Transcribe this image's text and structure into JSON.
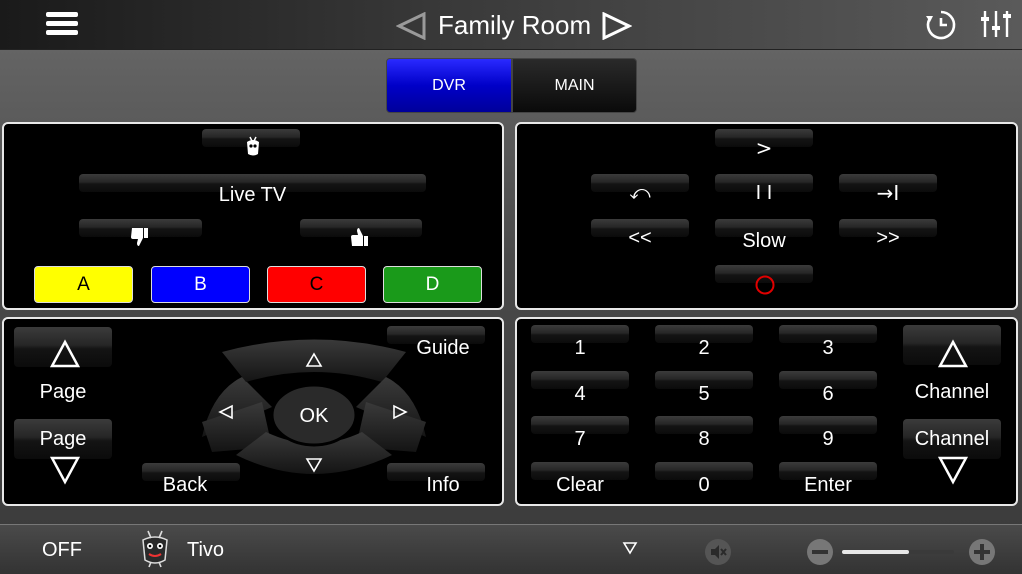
{
  "header": {
    "room_title": "Family Room",
    "menu_icon": "hamburger-menu-icon",
    "prev_icon": "triangle-left-icon",
    "next_icon": "triangle-right-icon",
    "clock_icon": "clock-icon",
    "settings_icon": "sliders-icon"
  },
  "tabs": {
    "dvr": "DVR",
    "main": "MAIN",
    "active_color": "#0000c8"
  },
  "panel1": {
    "tivo_icon": "tivo-logo-icon",
    "live_tv": "Live TV",
    "thumbs_down_icon": "thumbs-down-icon",
    "thumbs_up_icon": "thumbs-up-icon",
    "a": "A",
    "b": "B",
    "c": "C",
    "d": "D",
    "colors": {
      "a": "#ffff00",
      "b": "#0000ff",
      "c": "#ff0000",
      "d": "#1a9a1a"
    }
  },
  "panel2": {
    "play": ">",
    "replay": "⤺",
    "pause": "I I",
    "skip": "→I",
    "rewind": "<<",
    "slow": "Slow",
    "fast_forward": ">>",
    "record_icon": "record-icon",
    "record_color": "#e00000"
  },
  "panel3": {
    "page": "Page",
    "page_down": "Page",
    "guide": "Guide",
    "ok": "OK",
    "back": "Back",
    "info": "Info"
  },
  "panel4": {
    "keys": [
      "1",
      "2",
      "3",
      "4",
      "5",
      "6",
      "7",
      "8",
      "9",
      "Clear",
      "0",
      "Enter"
    ],
    "channel_up": "Channel",
    "channel_down": "Channel"
  },
  "footer": {
    "power": "OFF",
    "device": "Tivo",
    "device_icon": "tivo-mascot-icon",
    "dropdown_icon": "triangle-down-icon",
    "mute_icon": "mute-icon",
    "vol_down_icon": "minus-circle-icon",
    "vol_up_icon": "plus-circle-icon",
    "volume_level": 0.6
  }
}
